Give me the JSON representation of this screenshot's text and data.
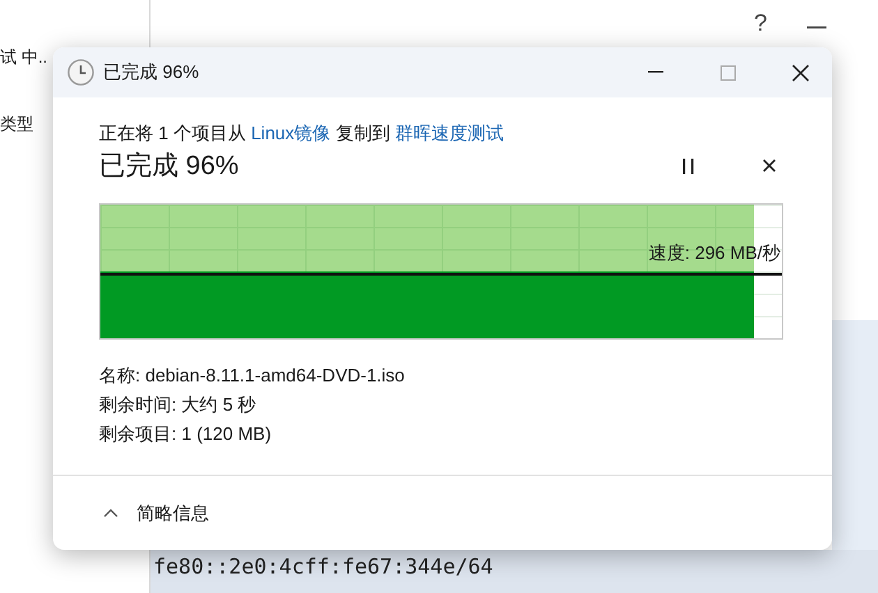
{
  "background": {
    "left_items": [
      "试 中..",
      "类型"
    ],
    "help_button": "?",
    "address": "fe80::2e0:4cff:fe67:344e/64"
  },
  "dialog": {
    "title": "已完成 96%",
    "message": [
      {
        "kind": "text",
        "text": "正在将 1 个项目从 "
      },
      {
        "kind": "link",
        "text": "Linux镜像"
      },
      {
        "kind": "text",
        "text": " 复制到 "
      },
      {
        "kind": "link",
        "text": "群晖速度测试"
      }
    ],
    "status": "已完成 96%",
    "paused": false,
    "progress": {
      "level": 0.96,
      "speed": "速度: 296 MB/秒"
    },
    "details": [
      "名称: debian-8.11.1-amd64-DVD-1.iso",
      "剩余时间: 大约 5 秒",
      "剩余项目: 1 (120 MB)"
    ],
    "footer": {
      "label": "简略信息",
      "expanded": true
    }
  }
}
